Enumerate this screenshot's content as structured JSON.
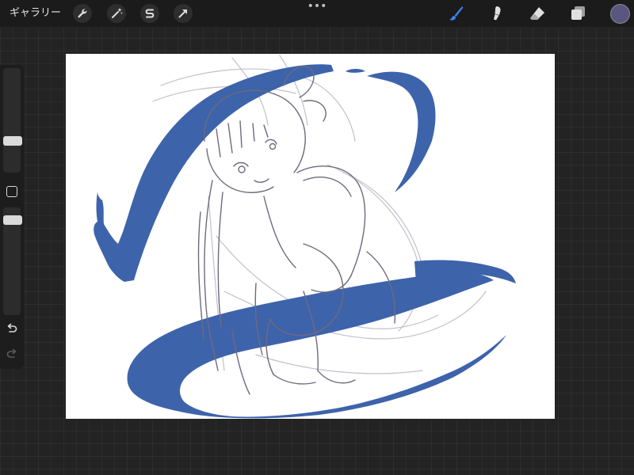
{
  "toolbar": {
    "gallery_label": "ギャラリー",
    "more_label": "•••",
    "left_tools": [
      "wrench-icon",
      "magic-wand-icon",
      "selection-s-icon",
      "transform-arrow-icon"
    ],
    "right_tools": [
      "brush-icon",
      "smudge-icon",
      "eraser-icon",
      "layers-icon"
    ],
    "active_tool": "brush-icon",
    "accent_color": "#3b82f6",
    "current_color": "#5a5680"
  },
  "sidebar": {
    "brush_size_level": 0.38,
    "opacity_level": 0.62,
    "icons": [
      "modify-square-icon",
      "undo-icon",
      "redo-icon"
    ]
  },
  "canvas": {
    "stroke_blue": "#3d63ab",
    "sketch_gray": "#6f6a7c"
  }
}
